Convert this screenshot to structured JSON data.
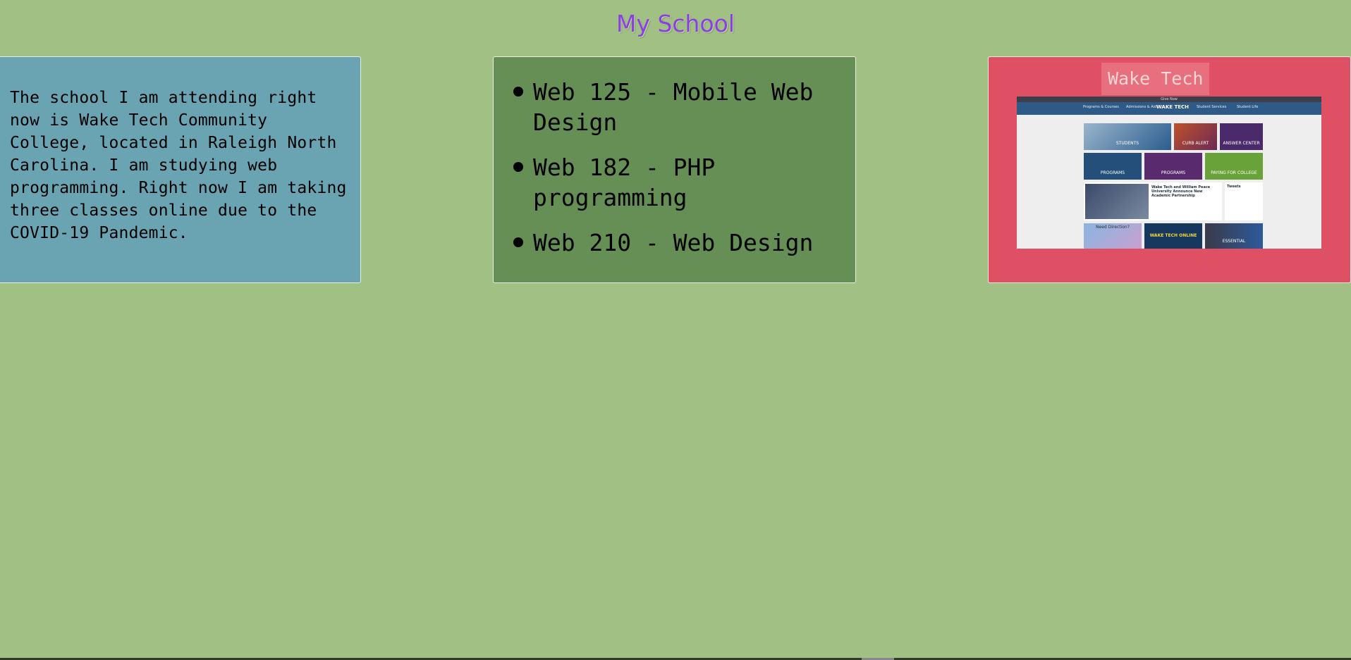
{
  "page": {
    "title": "My School"
  },
  "about": {
    "text": "The school I am attending right now is Wake Tech Community College, located in Raleigh North Carolina. I am studying web programming. Right now I am taking three classes online due to the COVID-19 Pandemic."
  },
  "classes": {
    "items": [
      {
        "label": "Web 125 - Mobile Web Design"
      },
      {
        "label": "Web 182 - PHP programming"
      },
      {
        "label": "Web 210 - Web Design"
      }
    ]
  },
  "school": {
    "name": "Wake Tech",
    "screenshot": {
      "topbar_text": "Give Now",
      "logo": "WAKE TECH",
      "nav": [
        "Programs & Courses",
        "Admissions & Aid",
        "Student Services",
        "Student Life"
      ],
      "tiles": [
        "STUDENTS",
        "CURB ALERT",
        "ANSWER CENTER",
        "PROGRAMS",
        "PROGRAMS",
        "PAYING FOR COLLEGE"
      ],
      "news_title": "Wake Tech and William Peace University Announce New Academic Partnership",
      "tweets_label": "Tweets",
      "bottom_tiles": [
        "Need Direction?",
        "WAKE TECH ONLINE",
        "ESSENTIAL"
      ]
    }
  },
  "colors": {
    "background": "#a1c083",
    "title": "#8a3fe0",
    "about_panel": "#6aa4b2",
    "classes_panel": "#658f55",
    "school_panel": "#e05064"
  }
}
